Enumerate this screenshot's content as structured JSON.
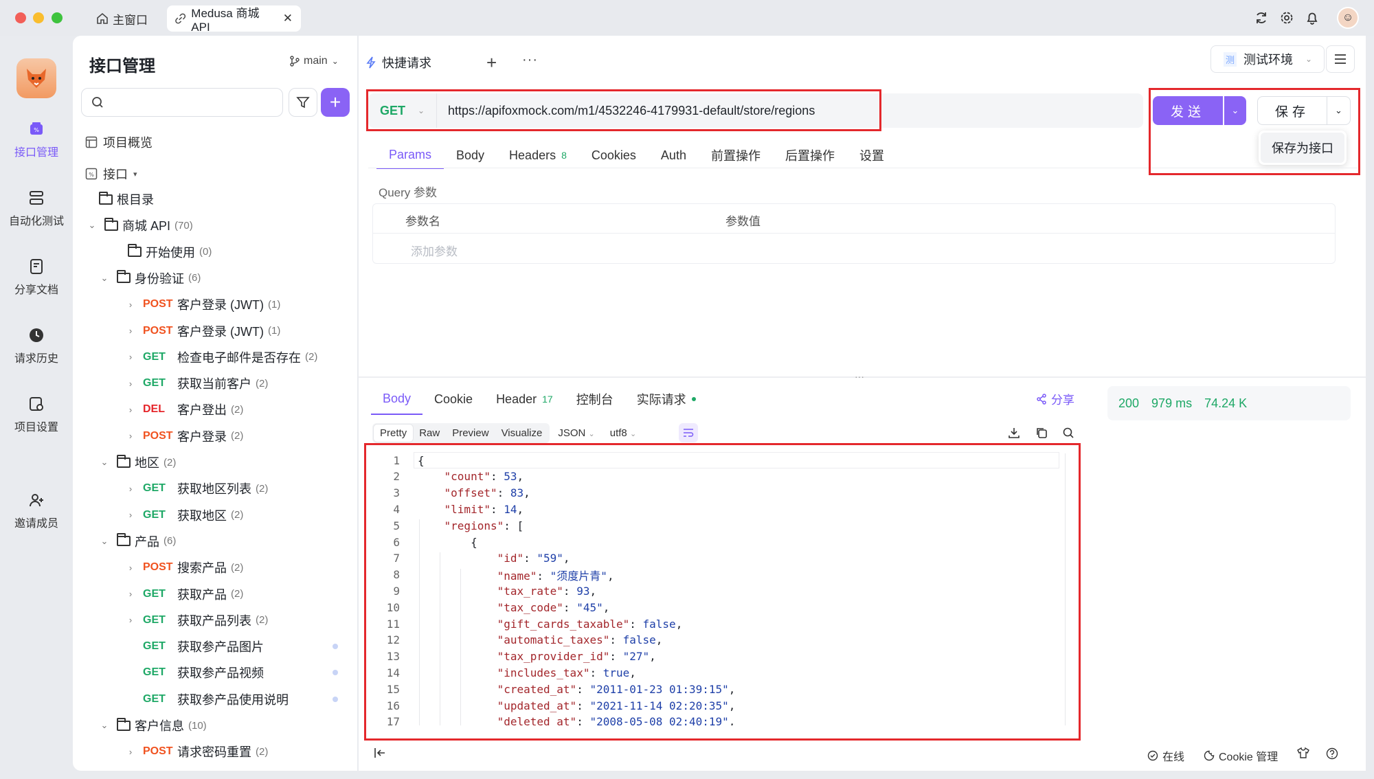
{
  "window": {
    "home_tab": "主窗口",
    "doc_tab": "Medusa 商城 API",
    "close_glyph": "✕"
  },
  "leftnav": {
    "items": [
      {
        "label": "接口管理"
      },
      {
        "label": "自动化测试"
      },
      {
        "label": "分享文档"
      },
      {
        "label": "请求历史"
      },
      {
        "label": "项目设置"
      },
      {
        "label": "邀请成员"
      }
    ]
  },
  "sidebar": {
    "title": "接口管理",
    "branch": "main",
    "search_placeholder": "",
    "overview": "项目概览",
    "api_section": "接口",
    "tree": [
      {
        "kind": "folder",
        "label": "根目录",
        "count": ""
      },
      {
        "kind": "folder",
        "label": "商城 API",
        "count": "(70)"
      },
      {
        "kind": "folder",
        "label": "开始使用",
        "count": "(0)"
      },
      {
        "kind": "folder",
        "label": "身份验证",
        "count": "(6)"
      },
      {
        "kind": "api",
        "method": "POST",
        "label": "客户登录 (JWT)",
        "count": "(1)"
      },
      {
        "kind": "api",
        "method": "POST",
        "label": "客户登录 (JWT)",
        "count": "(1)"
      },
      {
        "kind": "api",
        "method": "GET",
        "label": "检查电子邮件是否存在",
        "count": "(2)"
      },
      {
        "kind": "api",
        "method": "GET",
        "label": "获取当前客户",
        "count": "(2)"
      },
      {
        "kind": "api",
        "method": "DEL",
        "label": "客户登出",
        "count": "(2)"
      },
      {
        "kind": "api",
        "method": "POST",
        "label": "客户登录",
        "count": "(2)"
      },
      {
        "kind": "folder",
        "label": "地区",
        "count": "(2)"
      },
      {
        "kind": "api",
        "method": "GET",
        "label": "获取地区列表",
        "count": "(2)"
      },
      {
        "kind": "api",
        "method": "GET",
        "label": "获取地区",
        "count": "(2)"
      },
      {
        "kind": "folder",
        "label": "产品",
        "count": "(6)"
      },
      {
        "kind": "api",
        "method": "POST",
        "label": "搜索产品",
        "count": "(2)"
      },
      {
        "kind": "api",
        "method": "GET",
        "label": "获取产品",
        "count": "(2)"
      },
      {
        "kind": "api",
        "method": "GET",
        "label": "获取产品列表",
        "count": "(2)"
      },
      {
        "kind": "api",
        "method": "GET",
        "label": "获取参产品图片",
        "count": ""
      },
      {
        "kind": "api",
        "method": "GET",
        "label": "获取参产品视频",
        "count": ""
      },
      {
        "kind": "api",
        "method": "GET",
        "label": "获取参产品使用说明",
        "count": ""
      },
      {
        "kind": "folder",
        "label": "客户信息",
        "count": "(10)"
      },
      {
        "kind": "api",
        "method": "POST",
        "label": "请求密码重置",
        "count": "(2)"
      }
    ]
  },
  "request": {
    "tab_label": "快捷请求",
    "env_badge": "测",
    "env_name": "测试环境",
    "method": "GET",
    "url": "https://apifoxmock.com/m1/4532246-4179931-default/store/regions",
    "send_label": "发送",
    "save_label": "保存",
    "save_menu_item": "保存为接口",
    "tabs": [
      {
        "label": "Params",
        "badge": ""
      },
      {
        "label": "Body",
        "badge": ""
      },
      {
        "label": "Headers",
        "badge": "8"
      },
      {
        "label": "Cookies",
        "badge": ""
      },
      {
        "label": "Auth",
        "badge": ""
      },
      {
        "label": "前置操作",
        "badge": ""
      },
      {
        "label": "后置操作",
        "badge": ""
      },
      {
        "label": "设置",
        "badge": ""
      }
    ],
    "query_label": "Query 参数",
    "col_name": "参数名",
    "col_value": "参数值",
    "add_param_placeholder": "添加参数"
  },
  "response": {
    "tabs": [
      {
        "label": "Body",
        "badge": ""
      },
      {
        "label": "Cookie",
        "badge": ""
      },
      {
        "label": "Header",
        "badge": "17"
      },
      {
        "label": "控制台",
        "badge": ""
      },
      {
        "label": "实际请求",
        "badge": ""
      }
    ],
    "share_label": "分享",
    "status_code": "200",
    "time": "979 ms",
    "size": "74.24 K",
    "formats": [
      "Pretty",
      "Raw",
      "Preview",
      "Visualize"
    ],
    "lang": "JSON",
    "encoding": "utf8",
    "code_lines": [
      "{",
      "    \"count\": 53,",
      "    \"offset\": 83,",
      "    \"limit\": 14,",
      "    \"regions\": [",
      "        {",
      "            \"id\": \"59\",",
      "            \"name\": \"须度片青\",",
      "            \"tax_rate\": 93,",
      "            \"tax_code\": \"45\",",
      "            \"gift_cards_taxable\": false,",
      "            \"automatic_taxes\": false,",
      "            \"tax_provider_id\": \"27\",",
      "            \"includes_tax\": true,",
      "            \"created_at\": \"2011-01-23 01:39:15\",",
      "            \"updated_at\": \"2021-11-14 02:20:35\",",
      "            \"deleted_at\": \"2008-05-08 02:40:19\","
    ]
  },
  "footer": {
    "online": "在线",
    "cookie_mgmt": "Cookie 管理"
  },
  "colors": {
    "accent": "#8a63f5",
    "get": "#1ea866",
    "post": "#f0521f",
    "del": "#e5252a",
    "highlight_box": "#e4282c"
  }
}
